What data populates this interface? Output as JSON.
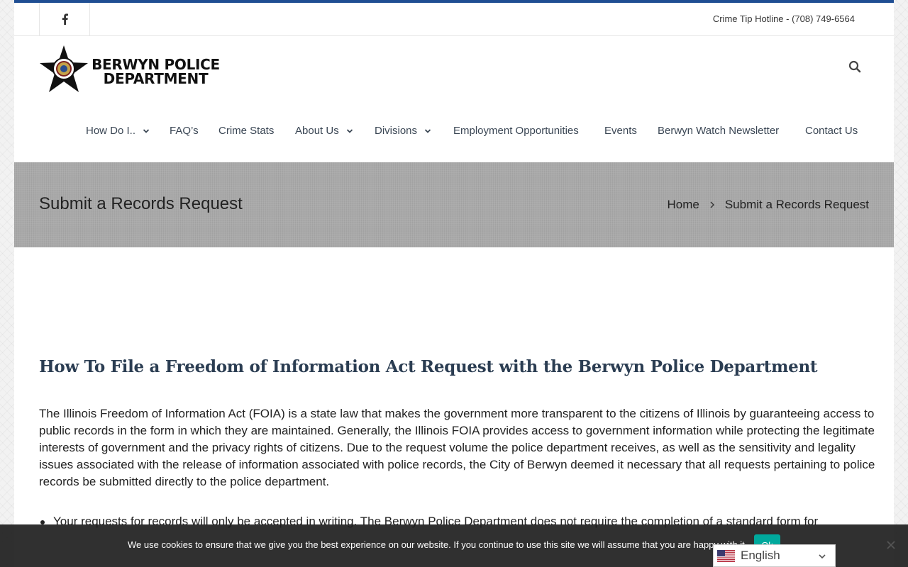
{
  "topbar": {
    "social_icon": "facebook-icon",
    "hotline": "Crime Tip Hotline - (708) 749-6564"
  },
  "logo": {
    "line1": "BERWYN POLICE",
    "line2": "DEPARTMENT"
  },
  "header": {
    "search_icon": "search-icon"
  },
  "nav": {
    "items": [
      {
        "label": "How Do I..",
        "has_dropdown": true
      },
      {
        "label": "FAQ’s",
        "has_dropdown": false
      },
      {
        "label": "Crime Stats",
        "has_dropdown": false
      },
      {
        "label": "About Us",
        "has_dropdown": true
      },
      {
        "label": "Divisions",
        "has_dropdown": true
      },
      {
        "label": "Employment Opportunities",
        "has_dropdown": false
      },
      {
        "label": "Events",
        "has_dropdown": false
      },
      {
        "label": "Berwyn Watch Newsletter",
        "has_dropdown": false
      },
      {
        "label": "Contact Us",
        "has_dropdown": false
      }
    ]
  },
  "banner": {
    "title": "Submit a Records Request",
    "breadcrumb": [
      "Home",
      "Submit a Records Request"
    ]
  },
  "content": {
    "heading": "How To File a Freedom of Information Act Request with the Berwyn Police Department",
    "paragraph": "The Illinois Freedom of Information Act (FOIA) is a state law that makes the government more transparent to the citizens of Illinois by guaranteeing access to public records in the form in which they are maintained.  Generally, the Illinois FOIA provides access to government information while protecting the legitimate interests of government and the privacy rights of citizens.  Due to the request volume the police department receives, as well as the sensitivity and legality issues associated with the release of information associated with police records, the City of Berwyn deemed it necessary that all requests pertaining to police records be submitted directly to the police department.",
    "bullet_1": "Your requests for records will only be accepted in writing. The Berwyn Police Department does not require the completion of a standard form for"
  },
  "cookie": {
    "text": "We use cookies to ensure that we give you the best experience on our website. If you continue to use this site we will assume that you are happy with it.",
    "ok_label": "Ok"
  },
  "language": {
    "selected": "English",
    "flag": "en-flag-icon"
  },
  "colors": {
    "top_accent": "#1f4e93",
    "heading": "#2b3d52",
    "cookie_button": "#00a99d"
  }
}
